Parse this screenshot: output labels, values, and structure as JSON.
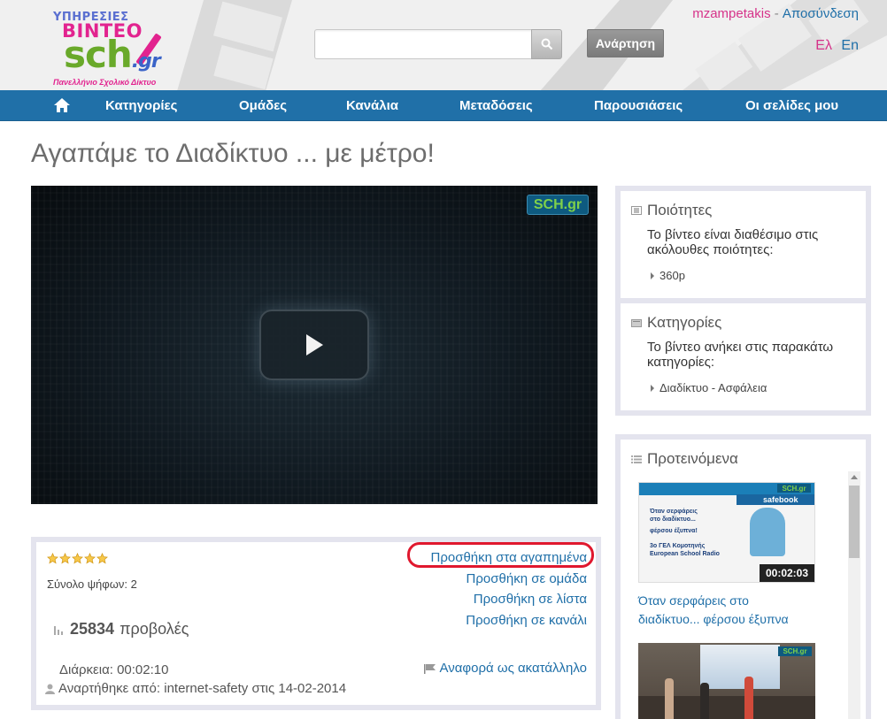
{
  "header": {
    "logo": {
      "line1": "ΥΠΗΡΕΣΙΕΣ",
      "line2": "ΒΙΝΤΕΟ",
      "line3": "sch",
      "line3_suffix": ".gr",
      "line4": "Πανελλήνιο Σχολικό Δίκτυο"
    },
    "search": {
      "value": "",
      "placeholder": ""
    },
    "upload_label": "Ανάρτηση",
    "user_name": "mzampetakis",
    "user_separator": " - ",
    "logout_label": "Αποσύνδεση",
    "lang_el": "Ελ",
    "lang_en": "En"
  },
  "nav": {
    "items": [
      "Κατηγορίες",
      "Ομάδες",
      "Κανάλια",
      "Μεταδόσεις",
      "Παρουσιάσεις",
      "Οι σελίδες μου"
    ]
  },
  "page": {
    "title": "Αγαπάμε το Διαδίκτυο ... με μέτρο!"
  },
  "video": {
    "watermark": "SCH.gr"
  },
  "info": {
    "rating_stars": 5,
    "votes_text": "Σύνολο ψήφων: 2",
    "views_count": "25834",
    "views_label": "προβολές",
    "duration_text": "Διάρκεια: 00:02:10",
    "uploaded_text": "Αναρτήθηκε από: internet-safety στις 14-02-2014",
    "actions": {
      "favorites": "Προσθήκη στα αγαπημένα",
      "group": "Προσθήκη σε ομάδα",
      "list": "Προσθήκη σε λίστα",
      "channel": "Προσθήκη σε κανάλι"
    },
    "report_label": "Αναφορά ως ακατάλληλο",
    "highlight_color": "#e0182e"
  },
  "sidebar": {
    "qualities": {
      "title": "Ποιότητες",
      "description": "Το βίντεο είναι διαθέσιμο στις ακόλουθες ποιότητες:",
      "items": [
        "360p"
      ]
    },
    "categories": {
      "title": "Κατηγορίες",
      "description": "Το βίντεο ανήκει στις παρακάτω κατηγορίες:",
      "items": [
        "Διαδίκτυο - Ασφάλεια"
      ]
    },
    "recommended": {
      "title": "Προτεινόμενα",
      "items": [
        {
          "caption": "Όταν σερφάρεις στο διαδίκτυο... φέρσου έξυπνα",
          "duration": "00:02:03",
          "thumb_badge": "SCH.gr",
          "thumb_safe": "safebook",
          "thumb_text1": "Όταν σερφάρεις",
          "thumb_text2": "στο διαδίκτυο...",
          "thumb_text3": "φέρσου έξυπνα!",
          "thumb_text4": "3ο ΓΕΛ Κομοτηνής",
          "thumb_text5": "European School Radio"
        },
        {
          "thumb_badge": "SCH.gr"
        }
      ]
    }
  },
  "colors": {
    "nav_bg": "#2070a8",
    "link": "#1f6fa8",
    "user_pink": "#d6338a",
    "panel_border": "#e4e4ee"
  }
}
